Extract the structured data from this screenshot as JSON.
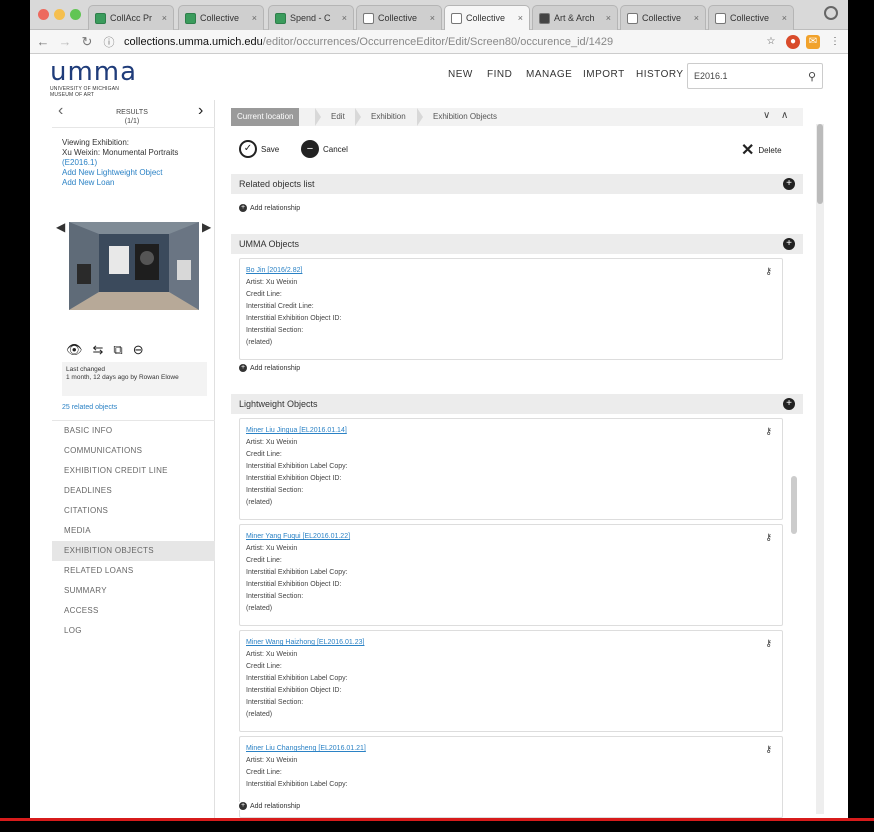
{
  "browser": {
    "tabs": [
      {
        "label": "CollAcc Pr",
        "icon": "green"
      },
      {
        "label": "Collective",
        "icon": "green"
      },
      {
        "label": "Spend - C",
        "icon": "green"
      },
      {
        "label": "Collective",
        "icon": "doc"
      },
      {
        "label": "Collective",
        "icon": "doc"
      },
      {
        "label": "Art & Arch",
        "icon": "dark"
      },
      {
        "label": "Collective",
        "icon": "doc"
      },
      {
        "label": "Collective",
        "icon": "doc"
      }
    ],
    "url_host": "collections.umma.umich.edu",
    "url_path": "/editor/occurrences/OccurrenceEditor/Edit/Screen80/occurence_id/1429"
  },
  "header": {
    "logo_word": "umma",
    "logo_sub": "University of Michigan Museum of Art",
    "nav": [
      "NEW",
      "FIND",
      "MANAGE",
      "IMPORT",
      "HISTORY"
    ],
    "search_value": "E2016.1"
  },
  "sidebar": {
    "results_label": "RESULTS",
    "results_count": "(1/1)",
    "viewing_label": "Viewing Exhibition:",
    "exhibition_title": "Xu Weixin: Monumental Portraits",
    "exhibition_id": "(E2016.1)",
    "add_lightweight": "Add New Lightweight Object",
    "add_loan": "Add New Loan",
    "last_changed_label": "Last changed",
    "last_changed_value": "1 month, 12 days ago by Rowan Elowe",
    "related_objects": "25 related objects",
    "menu": [
      "BASIC INFO",
      "COMMUNICATIONS",
      "EXHIBITION CREDIT LINE",
      "DEADLINES",
      "CITATIONS",
      "MEDIA",
      "EXHIBITION OBJECTS",
      "RELATED LOANS",
      "SUMMARY",
      "ACCESS",
      "LOG"
    ],
    "active_menu": "EXHIBITION OBJECTS"
  },
  "main": {
    "breadcrumbs": [
      "Current location",
      "Edit",
      "Exhibition",
      "Exhibition Objects"
    ],
    "save_label": "Save",
    "cancel_label": "Cancel",
    "delete_label": "Delete",
    "related_list_title": "Related objects list",
    "add_relationship": "Add relationship",
    "umma_title": "UMMA Objects",
    "umma_objects": [
      {
        "title": "Bo Jin [2016/2.82]",
        "lines": [
          "Artist: Xu Weixin",
          "Credit Line:",
          "Interstitial Credit Line:",
          "Interstitial Exhibition Object ID:",
          "Interstitial Section:",
          "(related)"
        ]
      }
    ],
    "lightweight_title": "Lightweight Objects",
    "lightweight_objects": [
      {
        "title": "Miner Liu Jingua [EL2016.01.14]",
        "lines": [
          "Artist: Xu Weixin",
          "Credit Line:",
          "Interstitial Exhibition Label Copy:",
          "Interstitial Exhibition Object ID:",
          "Interstitial Section:",
          "(related)"
        ]
      },
      {
        "title": "Miner Yang Fuqui [EL2016.01.22]",
        "lines": [
          "Artist: Xu Weixin",
          "Credit Line:",
          "Interstitial Exhibition Label Copy:",
          "Interstitial Exhibition Object ID:",
          "Interstitial Section:",
          "(related)"
        ]
      },
      {
        "title": "Miner Wang Haizhong [EL2016.01.23]",
        "lines": [
          "Artist: Xu Weixin",
          "Credit Line:",
          "Interstitial Exhibition Label Copy:",
          "Interstitial Exhibition Object ID:",
          "Interstitial Section:",
          "(related)"
        ]
      },
      {
        "title": "Miner Liu Changsheng [EL2016.01.21]",
        "lines": [
          "Artist: Xu Weixin",
          "Credit Line:",
          "Interstitial Exhibition Label Copy:"
        ]
      }
    ]
  },
  "colors": {
    "link": "#2b82c5",
    "logo": "#1f3c7a",
    "video_bar": "#d71b1b"
  }
}
